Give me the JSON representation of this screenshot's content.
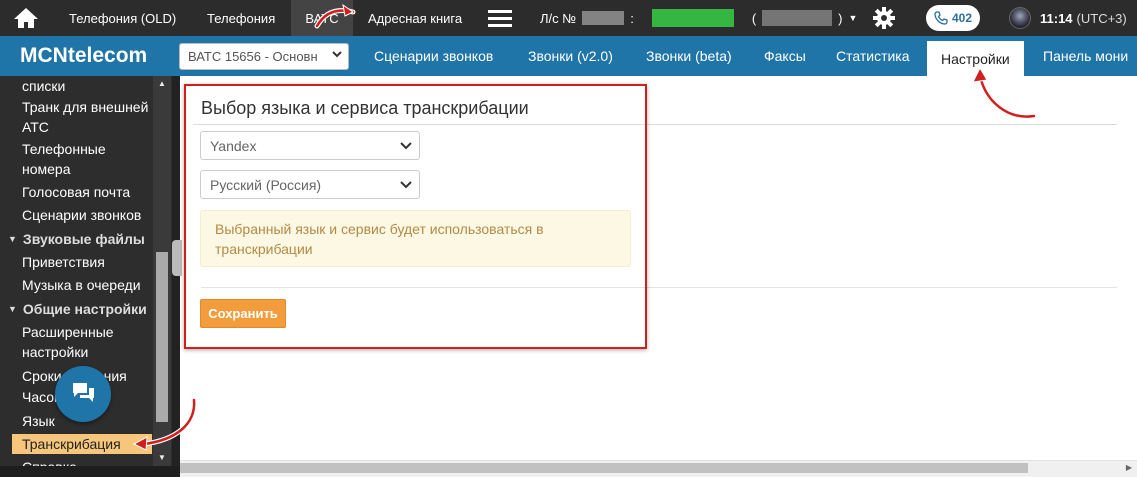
{
  "topbar": {
    "home_icon": "home-icon",
    "nav": [
      {
        "label": "Телефония (OLD)"
      },
      {
        "label": "Телефония"
      },
      {
        "label": "ВАТС"
      },
      {
        "label": "Адресная книга"
      }
    ],
    "active_nav": "ВАТС",
    "account_prefix": "Л/с №",
    "account_colon": ":",
    "account_paren": "(",
    "account_paren_close": ")",
    "phone_count": "402",
    "clock_time": "11:14",
    "clock_tz": "(UTC+3)"
  },
  "header": {
    "brand": "MCNtelecom",
    "vats_select_value": "ВАТС 15656 - Основн",
    "tabs": [
      {
        "label": "Сценарии звонков"
      },
      {
        "label": "Звонки (v2.0)"
      },
      {
        "label": "Звонки (beta)"
      },
      {
        "label": "Факсы"
      },
      {
        "label": "Статистика"
      },
      {
        "label": "Настройки"
      },
      {
        "label": "Панель мони"
      }
    ],
    "active_tab": "Настройки"
  },
  "sidebar": {
    "items": [
      {
        "label": "списки"
      },
      {
        "label": "Транк для внешней АТС"
      },
      {
        "label": "Телефонные номера"
      },
      {
        "label": "Голосовая почта"
      },
      {
        "label": "Сценарии звонков"
      },
      {
        "group": "Звуковые файлы"
      },
      {
        "label": "Приветствия"
      },
      {
        "label": "Музыка в очереди"
      },
      {
        "group": "Общие настройки"
      },
      {
        "label": "Расширенные настройки"
      },
      {
        "label": "Сроки хранения"
      },
      {
        "label": "Часовой пояс"
      },
      {
        "label": "Язык"
      },
      {
        "label": "Транскрибация"
      },
      {
        "label": "Справка"
      }
    ],
    "selected": "Транскрибация"
  },
  "main": {
    "title": "Выбор языка и сервиса транскрибации",
    "service_select": "Yandex",
    "language_select": "Русский (Россия)",
    "alert_text": "Выбранный язык и сервис будет использоваться в транскрибации",
    "save_label": "Сохранить"
  },
  "colors": {
    "topbar": "#2c2c2c",
    "brand_blue": "#1f75a8",
    "sidebar": "#2d2d2d",
    "selected_item": "#f5c67c",
    "save_button": "#f39c3c",
    "annotation_red": "#d0201e",
    "alert_bg": "#fcf8e3",
    "alert_text": "#b38a47"
  }
}
